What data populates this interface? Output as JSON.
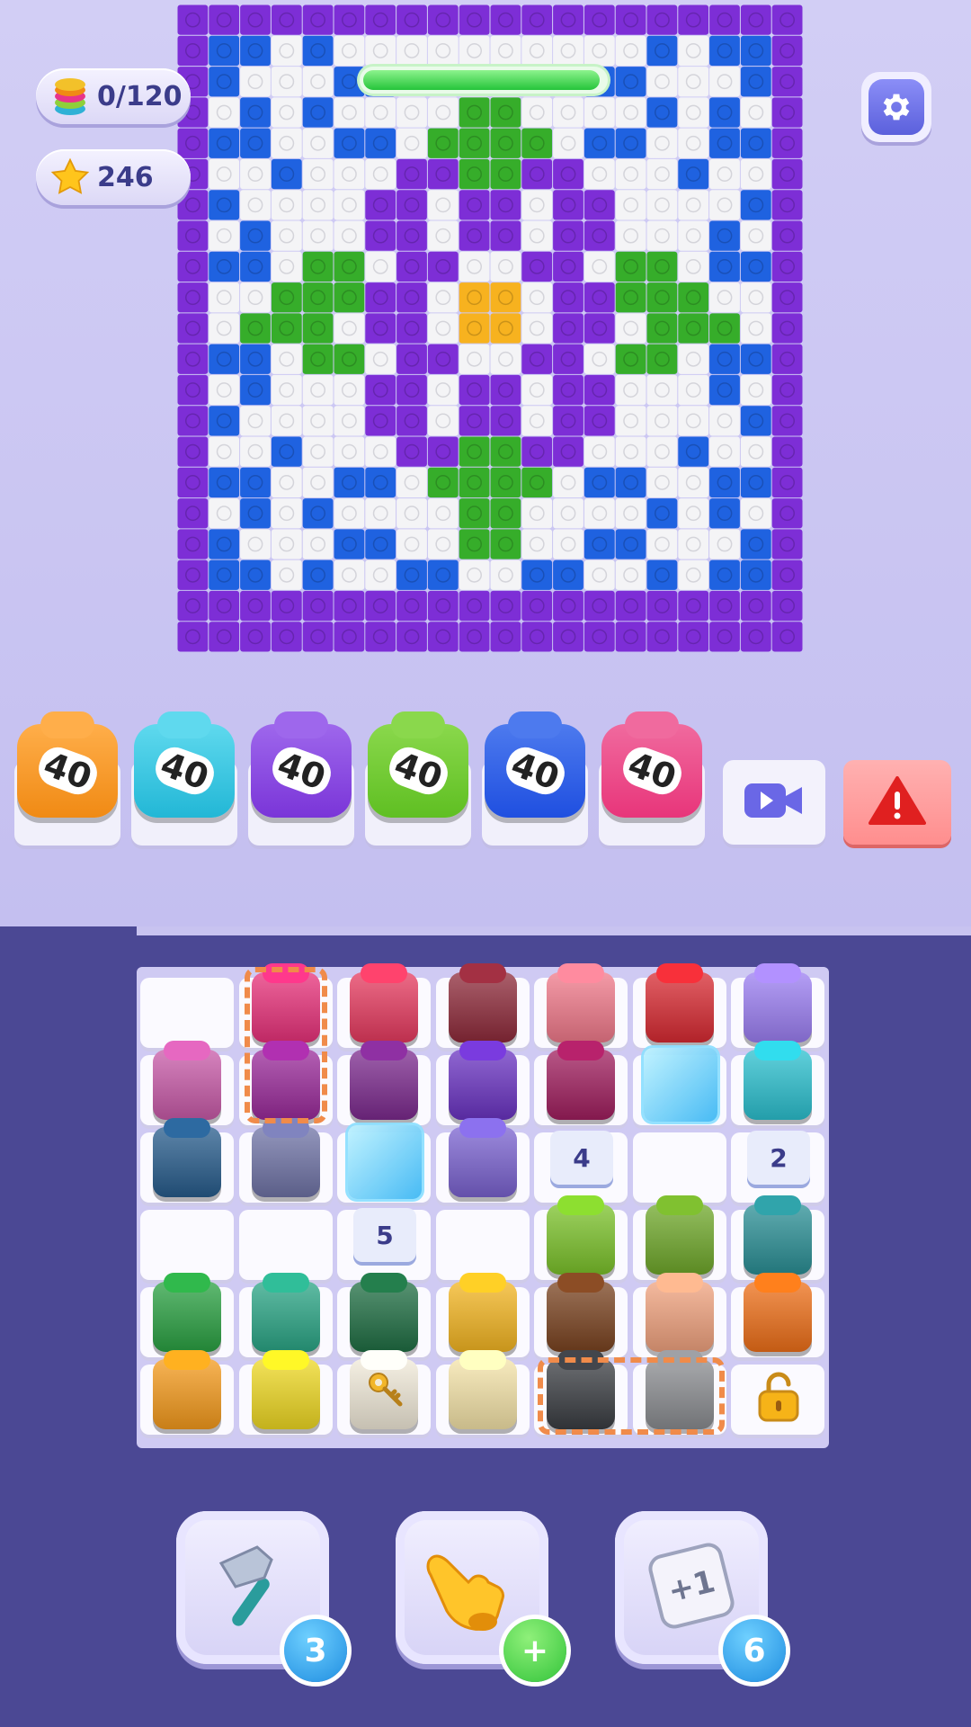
{
  "hud": {
    "coins_icon": "stack-icon",
    "coins_value": "0/120",
    "stars_icon": "star-icon",
    "stars_value": "246",
    "settings_icon": "gear-icon",
    "progress_fraction": 0.98
  },
  "mosaic": {
    "cols": 20,
    "rows": 21,
    "colors": {
      "P": "#7d2ed6",
      "B": "#1f62e0",
      "W": "#f4f4f6",
      "G": "#36ad2a",
      "Y": "#f7b21f"
    },
    "rows_data": [
      "PPPPPPPPPPPPPPPPPPPP",
      "PBBWBWWWWWWWWWWBWBBP",
      "PBWWWBBWWWWWWBBWWWBP",
      "PWBWBWWWWGGWWWWBWBWP",
      "PBBWWBBWGGGGWBBWWBBP",
      "PWWBWWWPPGGPPWWWBWWP",
      "PBWWWWPPWPPWPPWWWWBP",
      "PWBWWWPPWPPWPPWWWBWP",
      "PBBWGGWPPWWPPWGGWBBP",
      "PWWGGGPPWYYWPPGGGWWP",
      "PWGGGWPPWYYWPPWGGGWP",
      "PBBWGGWPPWWPPWGGWBBP",
      "PWBWWWPPWPPWPPWWWBWP",
      "PBWWWWPPWPPWPPWWWWBP",
      "PWWBWWWPPGGPPWWWBWWP",
      "PBBWWBBWGGGGWBBWWBBP",
      "PWBWBWWWWGGWWWWBWBWP",
      "PBWWWBBWWGGWWBBWWWBP",
      "PBBWBWWBBWWBBWWBWBBP",
      "PPPPPPPPPPPPPPPPPPPP",
      "PPPPPPPPPPPPPPPPPPPP"
    ]
  },
  "slots": [
    {
      "label": "40",
      "color": "#f08a14",
      "top": "#ffae4a"
    },
    {
      "label": "40",
      "color": "#22b7d6",
      "top": "#5fd9ee"
    },
    {
      "label": "40",
      "color": "#7a35d8",
      "top": "#9e67ec"
    },
    {
      "label": "40",
      "color": "#5fbf22",
      "top": "#8ad84c"
    },
    {
      "label": "40",
      "color": "#1f4fe0",
      "top": "#4d7aee"
    },
    {
      "label": "40",
      "color": "#e8357a",
      "top": "#f06a9e"
    }
  ],
  "actions": {
    "video_icon": "video-camera-icon",
    "alert_icon": "alert-icon"
  },
  "board": {
    "blocks": [
      {
        "r": 0,
        "c": 1,
        "color": "#e8317a"
      },
      {
        "r": 0,
        "c": 2,
        "color": "#e63a5f"
      },
      {
        "r": 0,
        "c": 3,
        "color": "#8e2a3a"
      },
      {
        "r": 0,
        "c": 4,
        "color": "#f0798a"
      },
      {
        "r": 0,
        "c": 5,
        "color": "#d82a32"
      },
      {
        "r": 0,
        "c": 6,
        "color": "#9b7ef2"
      },
      {
        "r": 1,
        "c": 0,
        "color": "#c85aa8"
      },
      {
        "r": 1,
        "c": 1,
        "color": "#9a2a9a"
      },
      {
        "r": 1,
        "c": 2,
        "color": "#7c2a8e"
      },
      {
        "r": 1,
        "c": 3,
        "color": "#6a33c2"
      },
      {
        "r": 1,
        "c": 4,
        "color": "#a01e5e"
      },
      {
        "r": 1,
        "c": 6,
        "color": "#2bc0cf"
      },
      {
        "r": 2,
        "c": 0,
        "color": "#275c8c"
      },
      {
        "r": 2,
        "c": 1,
        "color": "#6f73a6"
      },
      {
        "r": 2,
        "c": 3,
        "color": "#7a62d0"
      },
      {
        "r": 3,
        "c": 4,
        "color": "#7bc22a"
      },
      {
        "r": 3,
        "c": 5,
        "color": "#6fa82a"
      },
      {
        "r": 3,
        "c": 6,
        "color": "#2a8f95"
      },
      {
        "r": 4,
        "c": 0,
        "color": "#2aa142"
      },
      {
        "r": 4,
        "c": 1,
        "color": "#2aa585"
      },
      {
        "r": 4,
        "c": 2,
        "color": "#1f6e43"
      },
      {
        "r": 4,
        "c": 3,
        "color": "#f3b521"
      },
      {
        "r": 4,
        "c": 4,
        "color": "#7a4320"
      },
      {
        "r": 4,
        "c": 5,
        "color": "#f0a27e"
      },
      {
        "r": 4,
        "c": 6,
        "color": "#ee6f18"
      },
      {
        "r": 5,
        "c": 0,
        "color": "#f49a1c"
      },
      {
        "r": 5,
        "c": 1,
        "color": "#eed822"
      },
      {
        "r": 5,
        "c": 2,
        "color": "#f1ead9"
      },
      {
        "r": 5,
        "c": 3,
        "color": "#f4e3a8"
      },
      {
        "r": 5,
        "c": 4,
        "color": "#3a3d42"
      },
      {
        "r": 5,
        "c": 5,
        "color": "#8a8c90"
      }
    ],
    "ice": [
      {
        "r": 1,
        "c": 5
      },
      {
        "r": 2,
        "c": 2
      }
    ],
    "counters": [
      {
        "r": 2,
        "c": 4,
        "label": "4"
      },
      {
        "r": 2,
        "c": 6,
        "label": "2"
      },
      {
        "r": 3,
        "c": 2,
        "label": "5"
      }
    ],
    "key_icon": "key-icon",
    "lock_icon": "padlock-icon"
  },
  "tools": [
    {
      "icon": "hammer-icon",
      "badge": "3",
      "badge_color": "#1f8de0"
    },
    {
      "icon": "pointing-hand-icon",
      "badge": "+",
      "badge_color": "#33c43a"
    },
    {
      "icon": "plus-one-tile-icon",
      "label": "+1",
      "badge": "6",
      "badge_color": "#1f8de0"
    }
  ]
}
